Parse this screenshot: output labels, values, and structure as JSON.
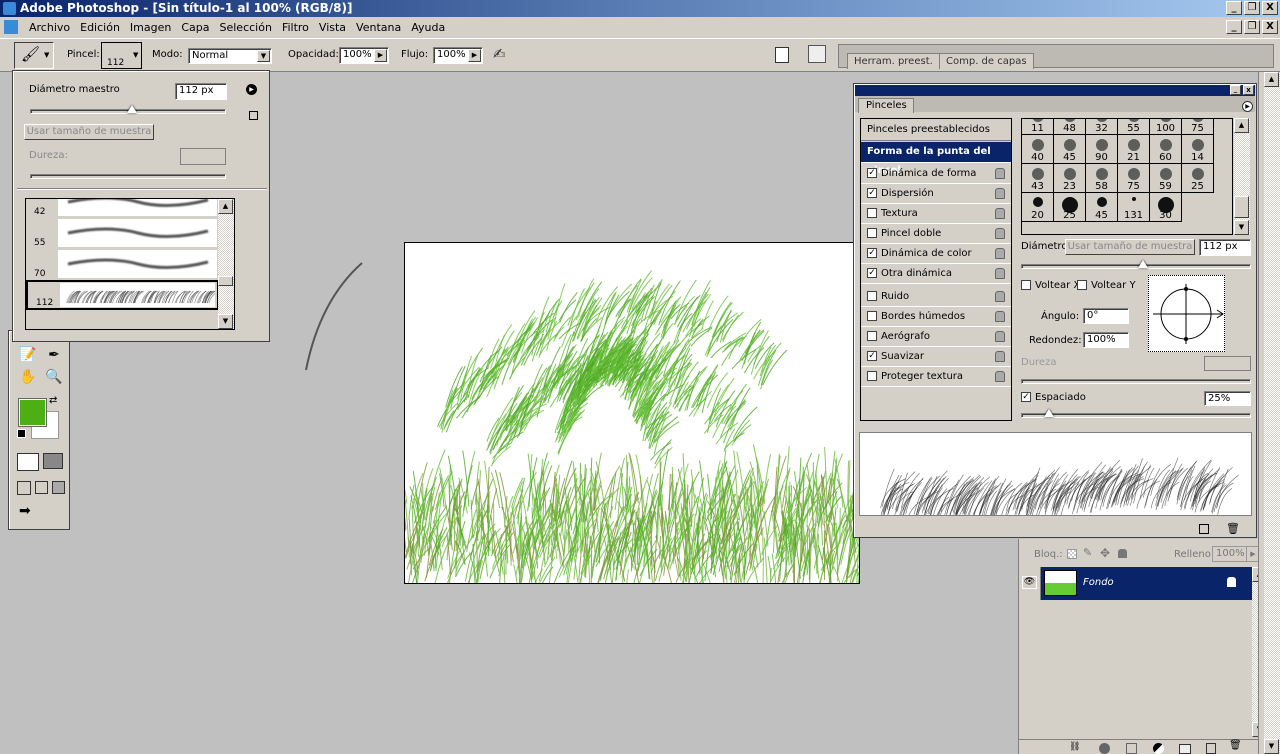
{
  "window": {
    "title": "Adobe Photoshop - [Sin título-1 al 100% (RGB/8)]",
    "min": "_",
    "restore": "❐",
    "close": "X"
  },
  "menu": [
    "Archivo",
    "Edición",
    "Imagen",
    "Capa",
    "Selección",
    "Filtro",
    "Vista",
    "Ventana",
    "Ayuda"
  ],
  "options": {
    "pincel_label": "Pincel:",
    "brush_size": "112",
    "modo_label": "Modo:",
    "modo_value": "Normal",
    "opacidad_label": "Opacidad:",
    "opacidad": "100%",
    "flujo_label": "Flujo:",
    "flujo": "100%"
  },
  "well_tabs": [
    "Herram. preest.",
    "Comp. de capas"
  ],
  "brush_popup": {
    "diameter_label": "Diámetro maestro",
    "diameter": "112 px",
    "sample_button": "Usar tamaño de muestra",
    "hardness_label": "Dureza:",
    "presets": [
      {
        "size": "42"
      },
      {
        "size": "55"
      },
      {
        "size": "70"
      },
      {
        "size": "112",
        "selected": true
      }
    ]
  },
  "colors": {
    "foreground": "#4caf14",
    "background": "#ffffff",
    "grass": "#5cb82e"
  },
  "brushes_panel": {
    "tab": "Pinceles",
    "sections": {
      "presets": "Pinceles preestablecidos",
      "tip_shape": "Forma de la punta del pincel"
    },
    "options": [
      {
        "label": "Dinámica de forma",
        "checked": true
      },
      {
        "label": "Dispersión",
        "checked": true
      },
      {
        "label": "Textura",
        "checked": false
      },
      {
        "label": "Pincel doble",
        "checked": false
      },
      {
        "label": "Dinámica de color",
        "checked": true
      },
      {
        "label": "Otra dinámica",
        "checked": true
      },
      {
        "label": "Ruido",
        "checked": false
      },
      {
        "label": "Bordes húmedos",
        "checked": false
      },
      {
        "label": "Aerógrafo",
        "checked": false
      },
      {
        "label": "Suavizar",
        "checked": true
      },
      {
        "label": "Proteger textura",
        "checked": false
      }
    ],
    "tips": [
      [
        "11",
        "48",
        "32",
        "55",
        "100",
        "75"
      ],
      [
        "40",
        "45",
        "90",
        "21",
        "60",
        "14"
      ],
      [
        "43",
        "23",
        "58",
        "75",
        "59",
        "25"
      ],
      [
        "20",
        "25",
        "45",
        "131",
        "30"
      ]
    ],
    "diameter_label": "Diámetro",
    "sample_button": "Usar tamaño de muestra",
    "diameter": "112 px",
    "flip_x": "Voltear X",
    "flip_y": "Voltear Y",
    "angle_label": "Ángulo:",
    "angle": "0°",
    "roundness_label": "Redondez:",
    "roundness": "100%",
    "hardness_label": "Dureza",
    "spacing_label": "Espaciado",
    "spacing": "25%",
    "spacing_checked": true
  },
  "layers": {
    "lock_label": "Bloq.:",
    "fill_label": "Relleno:",
    "fill": "100%",
    "items": [
      {
        "name": "Fondo",
        "visible": true,
        "locked": true
      }
    ]
  }
}
